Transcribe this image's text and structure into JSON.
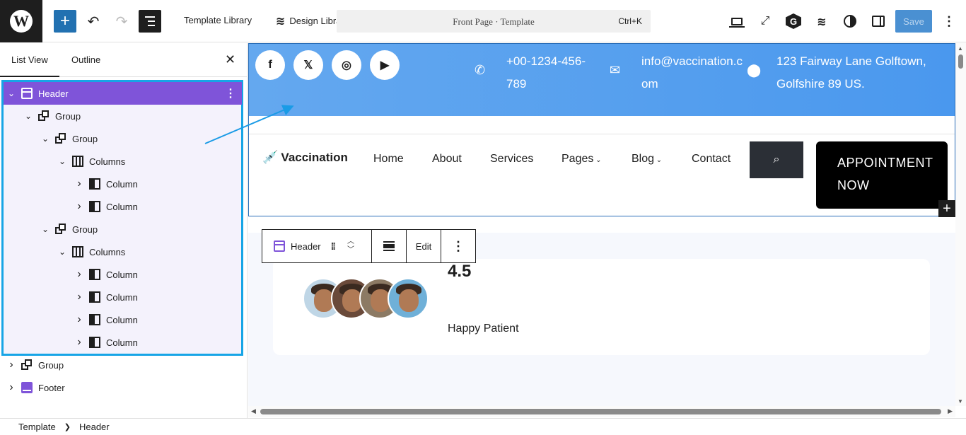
{
  "toolbar": {
    "template_library": "Template Library",
    "design_library": "Design Library",
    "doc_title": "Front Page · Template",
    "shortcut": "Ctrl+K",
    "save": "Save"
  },
  "sidebar": {
    "tabs": [
      "List View",
      "Outline"
    ],
    "tree": [
      {
        "label": "Header",
        "depth": 0,
        "icon": "header-block-icon",
        "expanded": true,
        "selected": true
      },
      {
        "label": "Group",
        "depth": 1,
        "icon": "group-block-icon",
        "expanded": true
      },
      {
        "label": "Group",
        "depth": 2,
        "icon": "group-block-icon",
        "expanded": true
      },
      {
        "label": "Columns",
        "depth": 3,
        "icon": "columns-block-icon",
        "expanded": true
      },
      {
        "label": "Column",
        "depth": 4,
        "icon": "column-block-icon",
        "expanded": false
      },
      {
        "label": "Column",
        "depth": 4,
        "icon": "column-block-icon",
        "expanded": false
      },
      {
        "label": "Group",
        "depth": 2,
        "icon": "group-block-icon",
        "expanded": true
      },
      {
        "label": "Columns",
        "depth": 3,
        "icon": "columns-block-icon",
        "expanded": true
      },
      {
        "label": "Column",
        "depth": 4,
        "icon": "column-block-icon",
        "expanded": false
      },
      {
        "label": "Column",
        "depth": 4,
        "icon": "column-block-icon",
        "expanded": false
      },
      {
        "label": "Column",
        "depth": 4,
        "icon": "column-block-icon",
        "expanded": false
      },
      {
        "label": "Column",
        "depth": 4,
        "icon": "column-block-icon",
        "expanded": false
      },
      {
        "label": "Group",
        "depth": 0,
        "icon": "group-block-icon",
        "expanded": false
      },
      {
        "label": "Footer",
        "depth": 0,
        "icon": "footer-block-icon",
        "expanded": false
      }
    ]
  },
  "breadcrumb": [
    "Template",
    "Header"
  ],
  "canvas": {
    "social": [
      "facebook-icon",
      "x-twitter-icon",
      "instagram-icon",
      "youtube-icon"
    ],
    "phone": "+00-1234-456-789",
    "email": "info@vaccination.com",
    "address": "123 Fairway Lane Golftown, Golfshire 89 US.",
    "logo": "Vaccination",
    "nav": [
      "Home",
      "About",
      "Services",
      "Pages",
      "Blog",
      "Contact"
    ],
    "appointment": "APPOINTMENT NOW",
    "rating": "4.5",
    "patients_label": "Happy Patient"
  },
  "block_toolbar": {
    "block": "Header",
    "edit": "Edit"
  },
  "colors": {
    "accent": "#2271b1",
    "selection": "#17a5e6",
    "header_block": "#7f54d9",
    "topstrip": "#4a98ee"
  }
}
